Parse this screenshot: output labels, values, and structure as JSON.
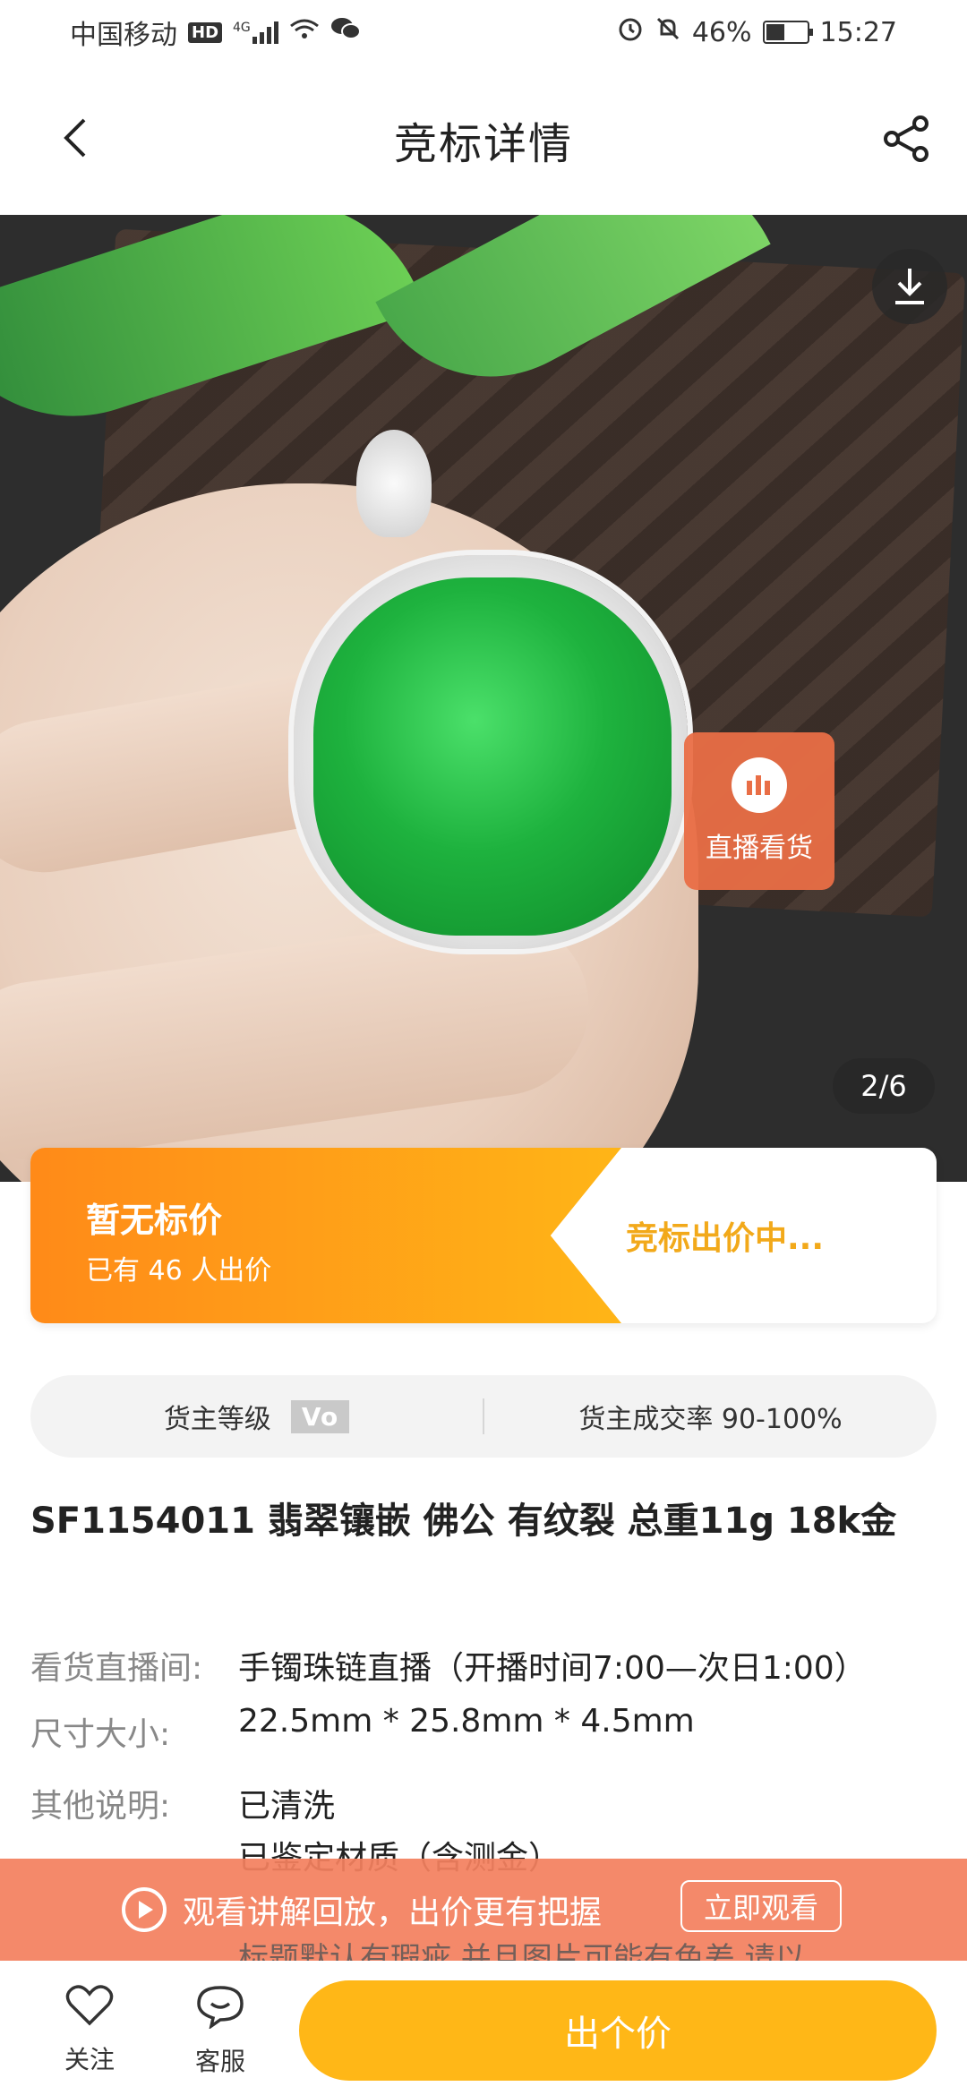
{
  "status_bar": {
    "carrier": "中国移动",
    "hd": "HD",
    "network": "4G",
    "battery": "46%",
    "battery_level": 0.46,
    "time": "15:27"
  },
  "nav": {
    "title": "竞标详情",
    "back_icon": "chevron-left-icon",
    "share_icon": "share-icon"
  },
  "gallery": {
    "live_label": "直播看货",
    "counter": "2/6",
    "download_icon": "download-icon"
  },
  "bid": {
    "no_price": "暂无标价",
    "bidders": "已有 46  人出价",
    "status": "竞标出价中..."
  },
  "seller": {
    "level_label": "货主等级",
    "level_badge": "Vo",
    "rate_label": "货主成交率 90-100%"
  },
  "product": {
    "title": "SF1154011 翡翠镶嵌 佛公   有纹裂  总重11g 18k金"
  },
  "details": [
    {
      "key": "看货直播间:",
      "value": "手镯珠链直播（开播时间7:00—次日1:00）"
    },
    {
      "key": "尺寸大小:",
      "value": "22.5mm * 25.8mm * 4.5mm"
    },
    {
      "key": "其他说明:",
      "value": "已清洗"
    }
  ],
  "details_more": [
    "已鉴定材质（含测金）",
    "标题默认有瑕疵 并且图片可能有色差 请以"
  ],
  "replay": {
    "text": "观看讲解回放，出价更有把握",
    "button": "立即观看"
  },
  "bottom": {
    "follow": "关注",
    "service": "客服",
    "bid_button": "出个价"
  },
  "colors": {
    "orange": "#ff8a18",
    "yellow": "#ffb717",
    "replay_bg": "#f3805f"
  }
}
